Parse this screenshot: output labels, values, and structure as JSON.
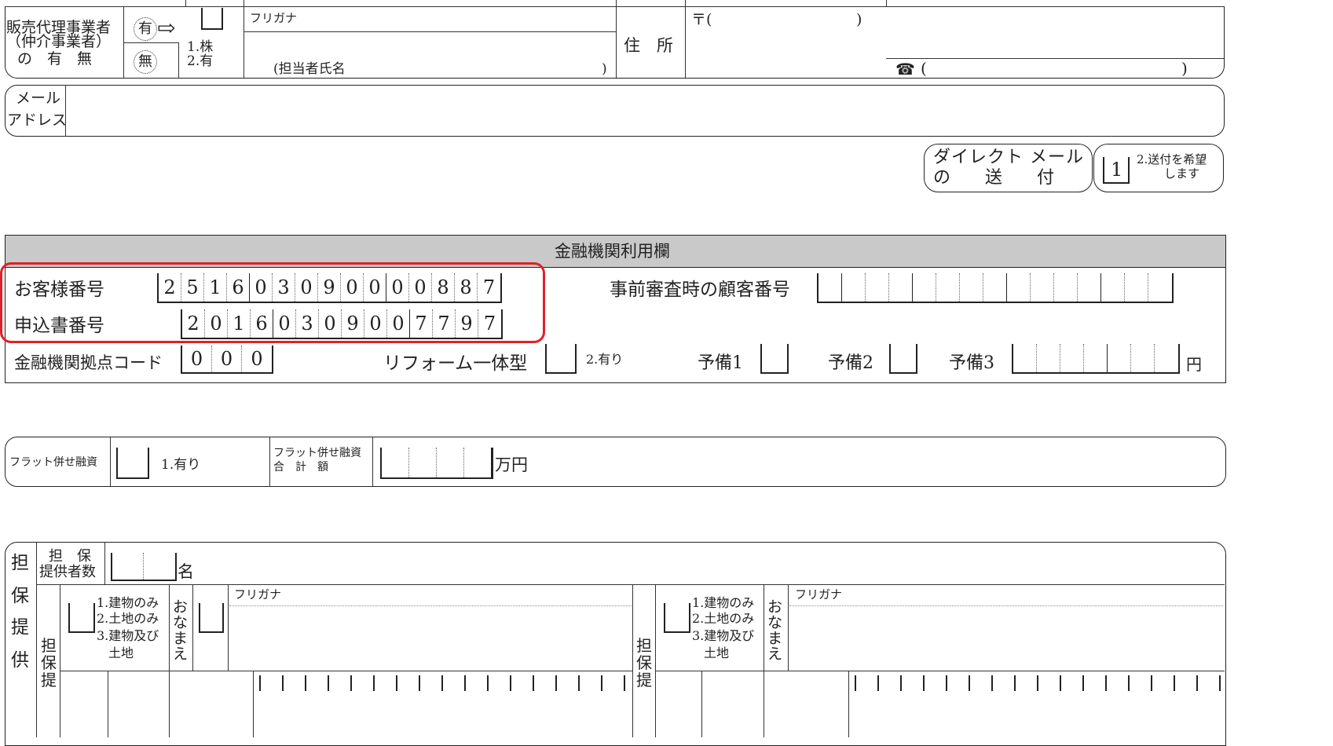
{
  "sales_agent": {
    "label": "販売代理事業者（仲介事業者）の　有　無",
    "label_line1": "販売代理事業者",
    "label_line2": "（仲介事業者）",
    "label_line3": "の　有　無",
    "option_yes": "有",
    "option_no": "無",
    "type_1": "1.株",
    "type_2": "2.有",
    "furigana": "フリガナ",
    "contact_name": "(担当者氏名",
    "address_label": "住　所",
    "postal": "〒(",
    "postal_close": ")",
    "tel_open": "(",
    "tel_close": ")"
  },
  "email": {
    "label_line1": "メール",
    "label_line2": "アドレス"
  },
  "direct_mail": {
    "label_line1": "ダイレクト メール",
    "label_line2": "の　　送　　付",
    "value": "1",
    "option_line1": "2.送付を希望",
    "option_line2": "します"
  },
  "bank_section": {
    "title": "金融機関利用欄",
    "customer_no_label": "お客様番号",
    "customer_no_digits": [
      "2",
      "5",
      "1",
      "6",
      "0",
      "3",
      "0",
      "9",
      "0",
      "0",
      "0",
      "0",
      "8",
      "8",
      "7"
    ],
    "application_no_label": "申込書番号",
    "application_no_digits": [
      "2",
      "0",
      "1",
      "6",
      "0",
      "3",
      "0",
      "9",
      "0",
      "0",
      "7",
      "7",
      "9",
      "7"
    ],
    "pre_review_label": "事前審査時の顧客番号",
    "branch_code_label": "金融機関拠点コード",
    "branch_code_digits": [
      "0",
      "0",
      "0"
    ],
    "reform_label": "リフォーム一体型",
    "reform_option": "2.有り",
    "reserve1_label": "予備1",
    "reserve2_label": "予備2",
    "reserve3_label": "予備3",
    "yen": "円"
  },
  "flat_combo": {
    "label": "フラット併せ融資",
    "option": "1.有り",
    "total_label_line1": "フラット併せ融資",
    "total_label_line2": "合　計　額",
    "unit": "万円"
  },
  "collateral": {
    "side_label": [
      "担",
      "保",
      "提",
      "供"
    ],
    "count_label_line1": "担　保",
    "count_label_line2": "提供者数",
    "count_unit": "名",
    "sub_label": [
      "担",
      "保",
      "提"
    ],
    "options": [
      "1.建物のみ",
      "2.土地のみ",
      "3.建物及び",
      "土地"
    ],
    "name_label": [
      "お",
      "な",
      "ま",
      "え"
    ],
    "furigana": "フリガナ"
  }
}
